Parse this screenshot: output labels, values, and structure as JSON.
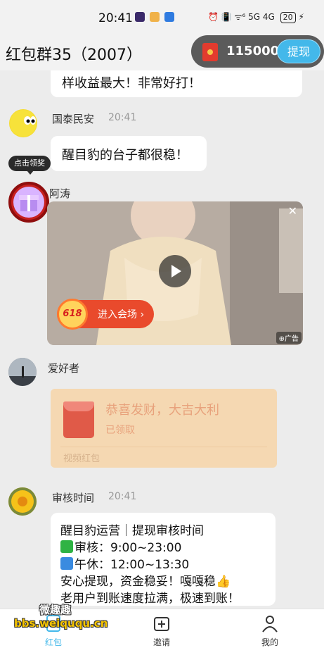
{
  "status_bar": {
    "time": "20:41",
    "indicators": "⏰ 📳 ᯤ⁶ 5G 4G",
    "battery": "20"
  },
  "header": {
    "title": "红包群35（2007）",
    "balance": "115000",
    "withdraw_label": "提现"
  },
  "messages": {
    "partial_text": "样收益最大！非常好打！",
    "msg1": {
      "sender": "国泰民安",
      "time": "20:41",
      "text": "醒目豹的台子都很稳！"
    },
    "reward_tag": "点击领奖",
    "msg2": {
      "sender": "阿涛"
    },
    "ad": {
      "cta_badge": "618",
      "cta_label": "进入会场 ›",
      "ad_label": "⊕广告",
      "close": "✕"
    },
    "msg3": {
      "sender": "爱好者"
    },
    "redpacket": {
      "title": "恭喜发财，大吉大利",
      "status": "已领取",
      "footer": "视频红包"
    },
    "msg4": {
      "sender": "审核时间",
      "time": "20:41",
      "line1": "醒目豹运营｜提现审核时间",
      "line2": "审核：9:00~23:00",
      "line3": "午休：12:00~13:30",
      "line4": "安心提现，资金稳妥！嘎嘎稳",
      "line5": "老用户到账速度拉满，极速到账！"
    }
  },
  "tabbar": {
    "tabs": [
      {
        "label": "红包"
      },
      {
        "label": "邀请"
      },
      {
        "label": "我的"
      }
    ]
  },
  "watermark": {
    "site": "bbs.weiququ.cn",
    "brand": "微趣趣"
  },
  "colors": {
    "accent": "#43b8ea",
    "red": "#e33b2e",
    "redpacket_bg": "#f5d8b2"
  }
}
